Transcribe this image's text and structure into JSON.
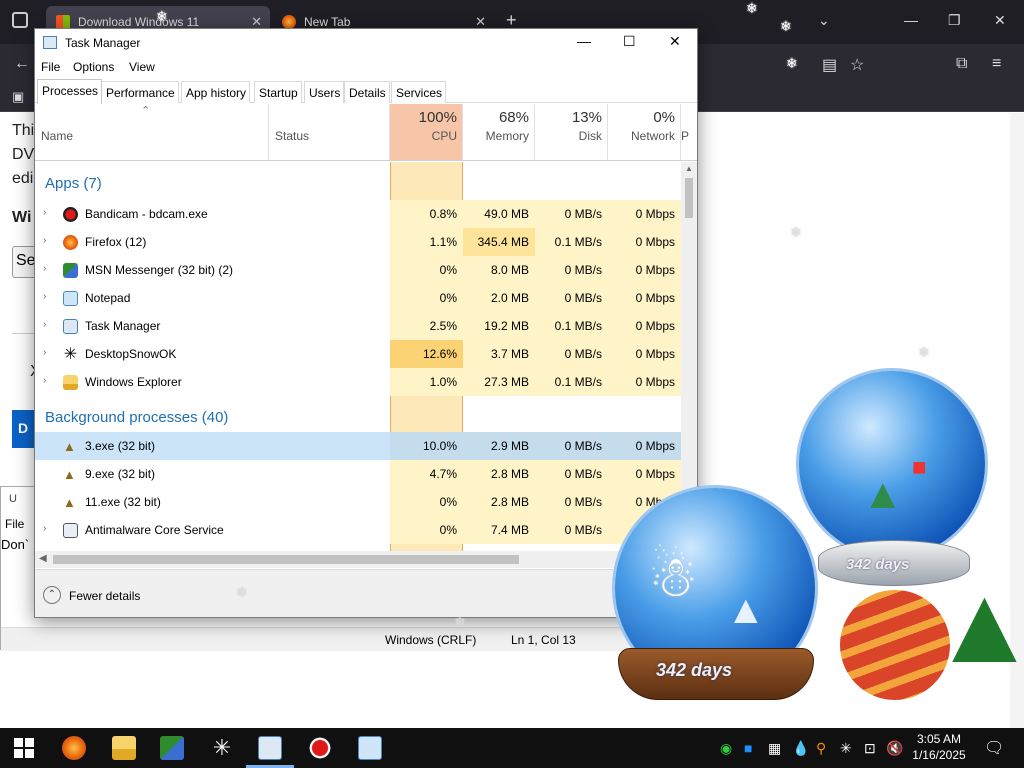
{
  "browser": {
    "tabs": [
      {
        "title": "Download Windows 11",
        "close": "✕"
      },
      {
        "title": "New Tab",
        "close": "✕"
      }
    ],
    "new_tab": "+",
    "tab_overflow": "chevron-down-icon",
    "window_controls": {
      "minimize": "—",
      "maximize": "❐",
      "close": "✕"
    },
    "page": {
      "line1": "Thi",
      "line2": "DV",
      "line3": "edi",
      "heading": "Wi",
      "button": "Se",
      "side_x": "X",
      "blue_btn": "D"
    }
  },
  "notepad": {
    "title": "U",
    "menu_file": "File",
    "text": "Don`",
    "status_eol": "Windows (CRLF)",
    "status_pos": "Ln 1, Col 13"
  },
  "task_manager": {
    "title": "Task Manager",
    "menu": [
      "File",
      "Options",
      "View"
    ],
    "tabs": [
      "Processes",
      "Performance",
      "App history",
      "Startup",
      "Users",
      "Details",
      "Services"
    ],
    "active_tab": "Processes",
    "columns": {
      "name": "Name",
      "status": "Status",
      "cpu_pct": "100%",
      "cpu": "CPU",
      "mem_pct": "68%",
      "mem": "Memory",
      "disk_pct": "13%",
      "disk": "Disk",
      "net_pct": "0%",
      "net": "Network",
      "power": "P"
    },
    "groups": {
      "apps": "Apps (7)",
      "background": "Background processes (40)"
    },
    "apps": [
      {
        "name": "Bandicam - bdcam.exe",
        "cpu": "0.8%",
        "mem": "49.0 MB",
        "disk": "0 MB/s",
        "net": "0 Mbps"
      },
      {
        "name": "Firefox (12)",
        "cpu": "1.1%",
        "mem": "345.4 MB",
        "disk": "0.1 MB/s",
        "net": "0 Mbps"
      },
      {
        "name": "MSN Messenger (32 bit) (2)",
        "cpu": "0%",
        "mem": "8.0 MB",
        "disk": "0 MB/s",
        "net": "0 Mbps"
      },
      {
        "name": "Notepad",
        "cpu": "0%",
        "mem": "2.0 MB",
        "disk": "0 MB/s",
        "net": "0 Mbps"
      },
      {
        "name": "Task Manager",
        "cpu": "2.5%",
        "mem": "19.2 MB",
        "disk": "0.1 MB/s",
        "net": "0 Mbps"
      },
      {
        "name": "DesktopSnowOK",
        "cpu": "12.6%",
        "mem": "3.7 MB",
        "disk": "0 MB/s",
        "net": "0 Mbps"
      },
      {
        "name": "Windows Explorer",
        "cpu": "1.0%",
        "mem": "27.3 MB",
        "disk": "0.1 MB/s",
        "net": "0 Mbps"
      }
    ],
    "background": [
      {
        "name": "3.exe (32 bit)",
        "cpu": "10.0%",
        "mem": "2.9 MB",
        "disk": "0 MB/s",
        "net": "0 Mbps"
      },
      {
        "name": "9.exe (32 bit)",
        "cpu": "4.7%",
        "mem": "2.8 MB",
        "disk": "0 MB/s",
        "net": "0 Mbps"
      },
      {
        "name": "11.exe (32 bit)",
        "cpu": "0%",
        "mem": "2.8 MB",
        "disk": "0 MB/s",
        "net": "0 Mbps"
      },
      {
        "name": "Antimalware Core Service",
        "cpu": "0%",
        "mem": "7.4 MB",
        "disk": "0 MB/s",
        "net": "0 Mbps"
      }
    ],
    "fewer_details": "Fewer details"
  },
  "widgets": {
    "globe_front_days": "342 days",
    "globe_back_days": "342 days"
  },
  "taskbar": {
    "time": "3:05 AM",
    "date": "1/16/2025"
  },
  "colors": {
    "cpu_header": "#f7c5a7",
    "cpu_band": "#fde9b8",
    "group_text": "#1e6fb4",
    "selected_row": "#cce4f7",
    "taskbar": "#101010"
  }
}
